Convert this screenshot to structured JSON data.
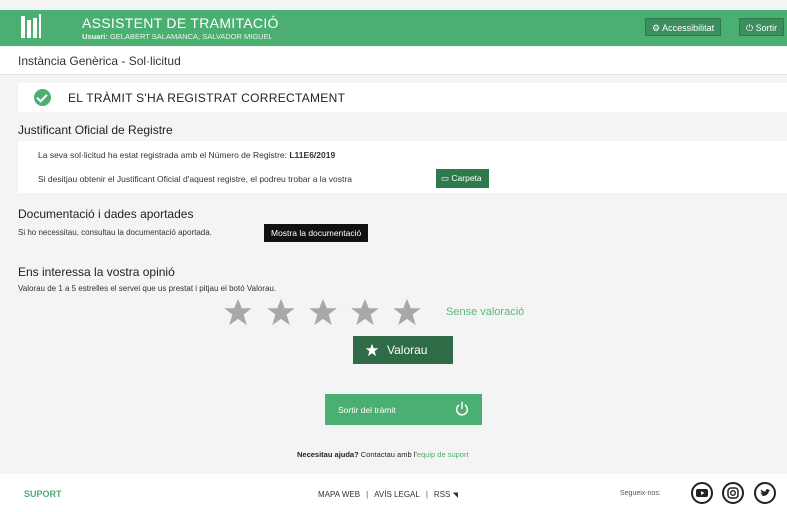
{
  "header": {
    "title": "ASSISTENT DE TRAMITACIÓ",
    "user_label": "Usuari:",
    "user_name": "GELABERT SALAMANCA, SALVADOR MIGUEL",
    "accessibility_label": "Accessibilitat",
    "exit_label": "Sortir"
  },
  "subheader": {
    "title": "Instància Genèrica - Sol·licitud"
  },
  "success": {
    "message": "EL TRÀMIT S'HA REGISTRAT CORRECTAMENT"
  },
  "justificant": {
    "heading": "Justificant Oficial de Registre",
    "line1": "La seva sol·licitud ha estat registrada amb el Número de Registre:",
    "registry_number": "L11E6/2019",
    "line2": "Si desitjau obtenir el Justificant Oficial d'aquest registre, el podreu trobar a la vostra",
    "folder_button": "Carpeta"
  },
  "documentacio": {
    "heading": "Documentació i dades aportades",
    "text": "Si ho necessitau, consultau la documentació aportada.",
    "button": "Mostra la documentació"
  },
  "opinio": {
    "heading": "Ens interessa la vostra opinió",
    "text": "Valorau de 1 a 5 estrelles el servei que us prestat i pitjau el botó Valorau.",
    "rating": 0,
    "max_rating": 5,
    "rating_status": "Sense valoració",
    "rate_button": "Valorau"
  },
  "exit_procedure": {
    "label": "Sortir del tràmit"
  },
  "help": {
    "question": "Necesitau ajuda?",
    "text": " Contactau amb l'",
    "link": "equip de suport"
  },
  "footer": {
    "support": "SUPORT",
    "links": [
      "MAPA WEB",
      "AVÍS LEGAL",
      "RSS"
    ],
    "follow": "Segueix-nos:"
  },
  "colors": {
    "brand_green": "#4caf72",
    "dark_green": "#2e6b46",
    "star_gray": "#a8a8a8"
  }
}
